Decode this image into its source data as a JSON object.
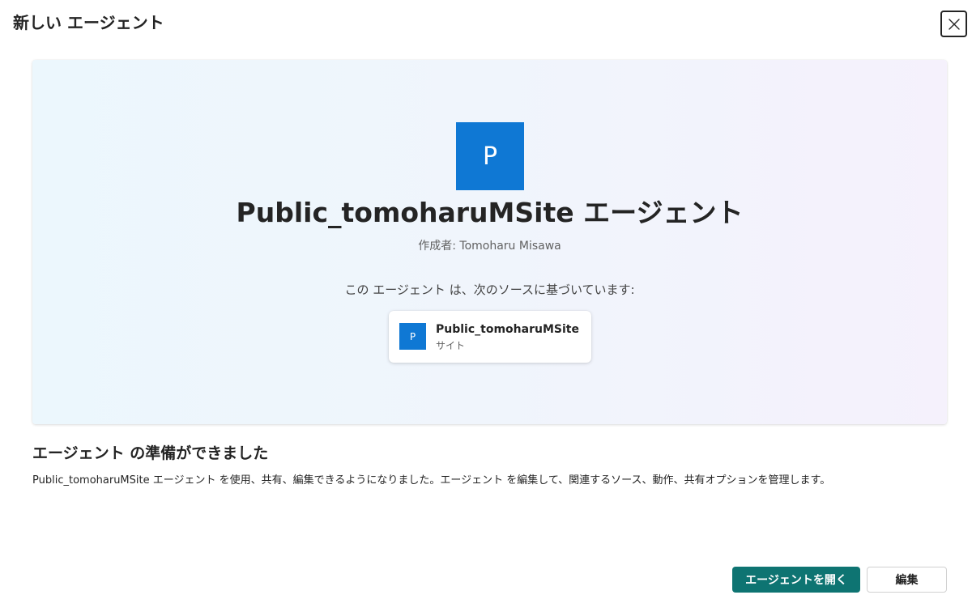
{
  "dialog": {
    "title": "新しい エージェント",
    "close_icon": "close-icon"
  },
  "hero": {
    "logo_letter": "P",
    "logo_color": "#0f78d4",
    "agent_name": "Public_tomoharuMSite エージェント",
    "author": "作成者: Tomoharu Misawa",
    "source_intro": "この エージェント は、次のソースに基づいています:",
    "source": {
      "icon_letter": "P",
      "name": "Public_tomoharuMSite",
      "type": "サイト"
    }
  },
  "ready": {
    "heading": "エージェント の準備ができました",
    "description": "Public_tomoharuMSite エージェント を使用、共有、編集できるようになりました。エージェント を編集して、関連するソース、動作、共有オプションを管理します。"
  },
  "actions": {
    "open_label": "エージェントを開く",
    "edit_label": "編集",
    "primary_color": "#0e7472"
  }
}
